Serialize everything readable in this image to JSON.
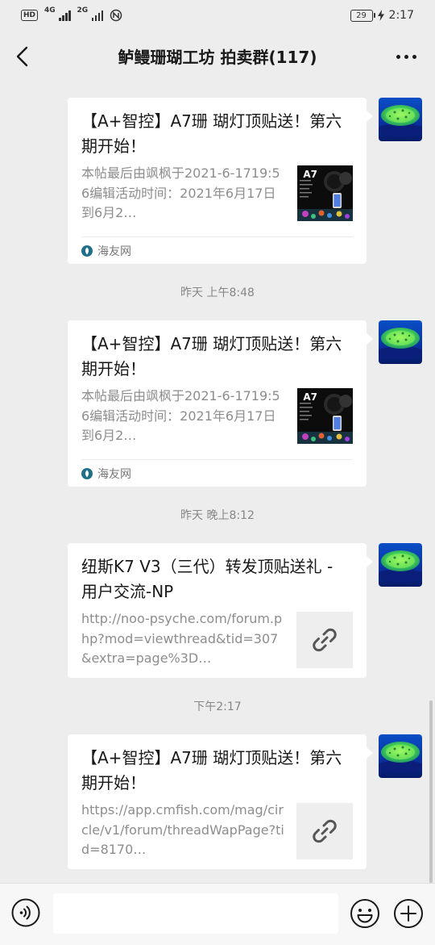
{
  "status_bar": {
    "hd": "HD",
    "net1": "4G",
    "net2": "2G",
    "battery": "29",
    "time": "2:17"
  },
  "nav": {
    "title": "鲈鳗珊瑚工坊 拍卖群(117)",
    "back_icon": "chevron-left-icon",
    "more_icon": "more-dots-icon"
  },
  "messages": [
    {
      "title": "【A+智控】A7珊 瑚灯顶贴送！第六期开始！",
      "desc": "本帖最后由飒枫于2021-6-1719:56编辑活动时间：2021年6月17日到6月2…",
      "thumb_label": "A7",
      "source": "海友网"
    },
    {
      "timestamp": "昨天 上午8:48",
      "title": "【A+智控】A7珊 瑚灯顶贴送！第六期开始！",
      "desc": "本帖最后由飒枫于2021-6-1719:56编辑活动时间：2021年6月17日到6月2…",
      "thumb_label": "A7",
      "source": "海友网"
    },
    {
      "timestamp": "昨天 晚上8:12",
      "title": "纽斯K7 V3（三代）转发顶贴送礼 - 用户交流-NP",
      "desc": "http://noo-psyche.com/forum.php?mod=viewthread&tid=307&extra=page%3D…"
    },
    {
      "timestamp": "下午2:17",
      "title": "【A+智控】A7珊 瑚灯顶贴送！第六期开始！",
      "desc": "https://app.cmfish.com/mag/circle/v1/forum/threadWapPage?tid=8170…"
    }
  ],
  "input_bar": {
    "placeholder": "",
    "voice_icon": "voice-icon",
    "emoji_icon": "emoji-icon",
    "plus_icon": "plus-icon"
  },
  "colors": {
    "background": "#ededed",
    "bubble": "#ffffff",
    "meta_text": "#8d8d8d",
    "title_text": "#191919"
  }
}
